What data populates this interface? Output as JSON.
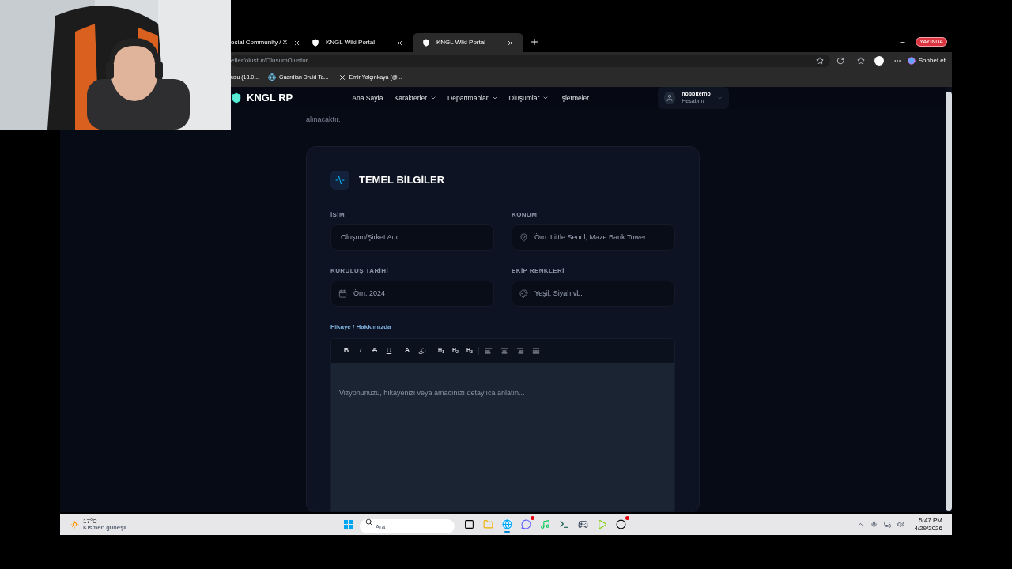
{
  "stream": {
    "badge": "YAYINDA"
  },
  "browser": {
    "tabs": [
      {
        "title": "ocial Community / X",
        "selected": false,
        "kind": "none"
      },
      {
        "title": "KNGL Wiki Portal",
        "selected": false,
        "kind": "shield"
      },
      {
        "title": "KNGL Wiki Portal",
        "selected": true,
        "kind": "shield"
      }
    ],
    "address": "etler/olustur/OlusumOlustur",
    "copilot": "Sohbet et",
    "bookmarks": [
      {
        "title": "usu (13.0...",
        "kind": "none"
      },
      {
        "title": "Guardian Druid Ta...",
        "kind": "globe"
      },
      {
        "title": "Emir Yalçınkaya (@...",
        "kind": "x"
      }
    ]
  },
  "site": {
    "brand": "KNGL RP",
    "nav": [
      {
        "label": "Ana Sayfa",
        "has_menu": false
      },
      {
        "label": "Karakterler",
        "has_menu": true
      },
      {
        "label": "Departmanlar",
        "has_menu": true
      },
      {
        "label": "Oluşumlar",
        "has_menu": true
      },
      {
        "label": "İşletmeler",
        "has_menu": false
      }
    ],
    "user": {
      "name": "hobbiterno",
      "role": "Hesabım"
    },
    "intro_tail": "alınacaktır.",
    "section": {
      "title": "TEMEL BİLGİLER",
      "fields": [
        {
          "label": "İSİM",
          "placeholder": "Oluşum/Şirket Adı",
          "kind": "text"
        },
        {
          "label": "KONUM",
          "placeholder": "Örn: Little Seoul, Maze Bank Tower...",
          "kind": "location"
        },
        {
          "label": "KURULUŞ TARİHİ",
          "placeholder": "Örn: 2024",
          "kind": "date"
        },
        {
          "label": "EKİP RENKLERİ",
          "placeholder": "Yeşil, Siyah vb.",
          "kind": "colors"
        }
      ],
      "editor": {
        "label": "Hikaye / Hakkımızda",
        "placeholder": "Vizyonunuzu, hikayenizi veya amacınızı detaylıca anlatın...",
        "toolbar": [
          [
            {
              "kind": "bold",
              "text": "B"
            },
            {
              "kind": "italic",
              "text": "I"
            },
            {
              "kind": "strike",
              "text": "S"
            },
            {
              "kind": "underline",
              "text": "U"
            }
          ],
          [
            {
              "kind": "text-color",
              "text": "A"
            },
            {
              "kind": "highlight"
            }
          ],
          [
            {
              "kind": "heading",
              "text": "H$_{1}$"
            },
            {
              "kind": "heading",
              "text": "H$_{2}$"
            },
            {
              "kind": "heading",
              "text": "H$_{3}$"
            }
          ],
          [
            {
              "kind": "align-left"
            },
            {
              "kind": "align-center"
            },
            {
              "kind": "align-right"
            },
            {
              "kind": "align-justify"
            }
          ]
        ]
      }
    }
  },
  "taskbar": {
    "temperature": "17°C",
    "weather": "Kısmen güneşli",
    "search_placeholder": "Ara",
    "apps": [
      {
        "kind": "task-view"
      },
      {
        "kind": "folder"
      },
      {
        "kind": "browser",
        "active": true
      },
      {
        "kind": "chat",
        "badge": true
      },
      {
        "kind": "music",
        "badge": false
      },
      {
        "kind": "terminal",
        "badge": false
      },
      {
        "kind": "game",
        "badge": false
      },
      {
        "kind": "media",
        "badge": false
      },
      {
        "kind": "record",
        "badge": true
      }
    ],
    "time": "5:47 PM",
    "date": "4/29/2026"
  }
}
